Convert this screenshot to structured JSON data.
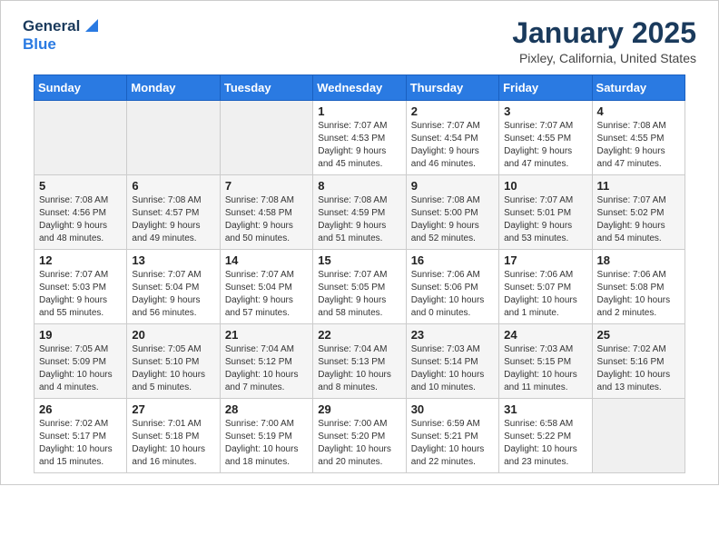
{
  "header": {
    "logo_general": "General",
    "logo_blue": "Blue",
    "month_title": "January 2025",
    "location": "Pixley, California, United States"
  },
  "weekdays": [
    "Sunday",
    "Monday",
    "Tuesday",
    "Wednesday",
    "Thursday",
    "Friday",
    "Saturday"
  ],
  "weeks": [
    [
      {
        "day": "",
        "info": ""
      },
      {
        "day": "",
        "info": ""
      },
      {
        "day": "",
        "info": ""
      },
      {
        "day": "1",
        "info": "Sunrise: 7:07 AM\nSunset: 4:53 PM\nDaylight: 9 hours\nand 45 minutes."
      },
      {
        "day": "2",
        "info": "Sunrise: 7:07 AM\nSunset: 4:54 PM\nDaylight: 9 hours\nand 46 minutes."
      },
      {
        "day": "3",
        "info": "Sunrise: 7:07 AM\nSunset: 4:55 PM\nDaylight: 9 hours\nand 47 minutes."
      },
      {
        "day": "4",
        "info": "Sunrise: 7:08 AM\nSunset: 4:55 PM\nDaylight: 9 hours\nand 47 minutes."
      }
    ],
    [
      {
        "day": "5",
        "info": "Sunrise: 7:08 AM\nSunset: 4:56 PM\nDaylight: 9 hours\nand 48 minutes."
      },
      {
        "day": "6",
        "info": "Sunrise: 7:08 AM\nSunset: 4:57 PM\nDaylight: 9 hours\nand 49 minutes."
      },
      {
        "day": "7",
        "info": "Sunrise: 7:08 AM\nSunset: 4:58 PM\nDaylight: 9 hours\nand 50 minutes."
      },
      {
        "day": "8",
        "info": "Sunrise: 7:08 AM\nSunset: 4:59 PM\nDaylight: 9 hours\nand 51 minutes."
      },
      {
        "day": "9",
        "info": "Sunrise: 7:08 AM\nSunset: 5:00 PM\nDaylight: 9 hours\nand 52 minutes."
      },
      {
        "day": "10",
        "info": "Sunrise: 7:07 AM\nSunset: 5:01 PM\nDaylight: 9 hours\nand 53 minutes."
      },
      {
        "day": "11",
        "info": "Sunrise: 7:07 AM\nSunset: 5:02 PM\nDaylight: 9 hours\nand 54 minutes."
      }
    ],
    [
      {
        "day": "12",
        "info": "Sunrise: 7:07 AM\nSunset: 5:03 PM\nDaylight: 9 hours\nand 55 minutes."
      },
      {
        "day": "13",
        "info": "Sunrise: 7:07 AM\nSunset: 5:04 PM\nDaylight: 9 hours\nand 56 minutes."
      },
      {
        "day": "14",
        "info": "Sunrise: 7:07 AM\nSunset: 5:04 PM\nDaylight: 9 hours\nand 57 minutes."
      },
      {
        "day": "15",
        "info": "Sunrise: 7:07 AM\nSunset: 5:05 PM\nDaylight: 9 hours\nand 58 minutes."
      },
      {
        "day": "16",
        "info": "Sunrise: 7:06 AM\nSunset: 5:06 PM\nDaylight: 10 hours\nand 0 minutes."
      },
      {
        "day": "17",
        "info": "Sunrise: 7:06 AM\nSunset: 5:07 PM\nDaylight: 10 hours\nand 1 minute."
      },
      {
        "day": "18",
        "info": "Sunrise: 7:06 AM\nSunset: 5:08 PM\nDaylight: 10 hours\nand 2 minutes."
      }
    ],
    [
      {
        "day": "19",
        "info": "Sunrise: 7:05 AM\nSunset: 5:09 PM\nDaylight: 10 hours\nand 4 minutes."
      },
      {
        "day": "20",
        "info": "Sunrise: 7:05 AM\nSunset: 5:10 PM\nDaylight: 10 hours\nand 5 minutes."
      },
      {
        "day": "21",
        "info": "Sunrise: 7:04 AM\nSunset: 5:12 PM\nDaylight: 10 hours\nand 7 minutes."
      },
      {
        "day": "22",
        "info": "Sunrise: 7:04 AM\nSunset: 5:13 PM\nDaylight: 10 hours\nand 8 minutes."
      },
      {
        "day": "23",
        "info": "Sunrise: 7:03 AM\nSunset: 5:14 PM\nDaylight: 10 hours\nand 10 minutes."
      },
      {
        "day": "24",
        "info": "Sunrise: 7:03 AM\nSunset: 5:15 PM\nDaylight: 10 hours\nand 11 minutes."
      },
      {
        "day": "25",
        "info": "Sunrise: 7:02 AM\nSunset: 5:16 PM\nDaylight: 10 hours\nand 13 minutes."
      }
    ],
    [
      {
        "day": "26",
        "info": "Sunrise: 7:02 AM\nSunset: 5:17 PM\nDaylight: 10 hours\nand 15 minutes."
      },
      {
        "day": "27",
        "info": "Sunrise: 7:01 AM\nSunset: 5:18 PM\nDaylight: 10 hours\nand 16 minutes."
      },
      {
        "day": "28",
        "info": "Sunrise: 7:00 AM\nSunset: 5:19 PM\nDaylight: 10 hours\nand 18 minutes."
      },
      {
        "day": "29",
        "info": "Sunrise: 7:00 AM\nSunset: 5:20 PM\nDaylight: 10 hours\nand 20 minutes."
      },
      {
        "day": "30",
        "info": "Sunrise: 6:59 AM\nSunset: 5:21 PM\nDaylight: 10 hours\nand 22 minutes."
      },
      {
        "day": "31",
        "info": "Sunrise: 6:58 AM\nSunset: 5:22 PM\nDaylight: 10 hours\nand 23 minutes."
      },
      {
        "day": "",
        "info": ""
      }
    ]
  ]
}
